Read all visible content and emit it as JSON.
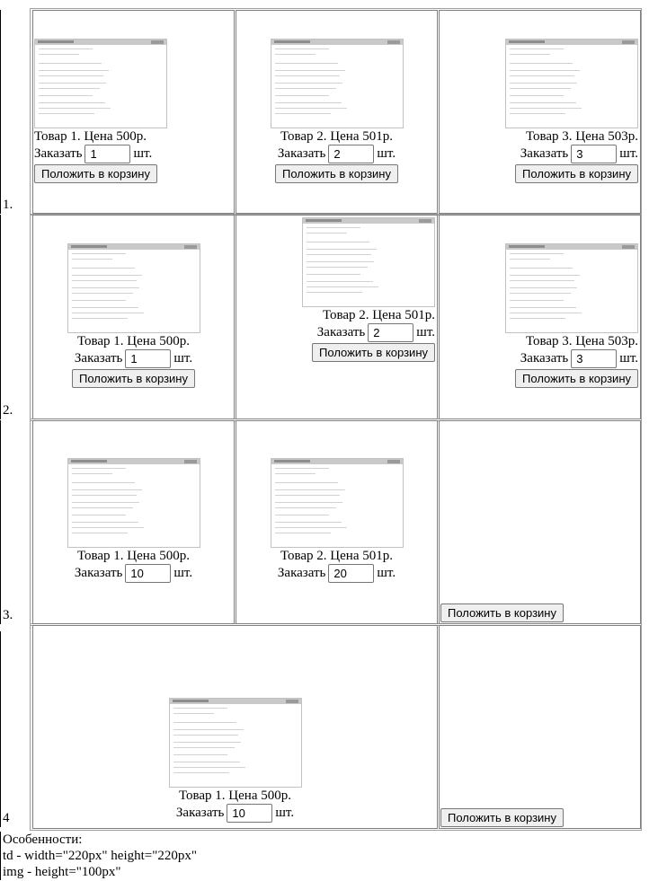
{
  "rows": [
    {
      "label": "1.",
      "cells": [
        {
          "title": "Товар 1. Цена 500р.",
          "order_label": "Заказать",
          "qty": "1",
          "unit": "шт.",
          "button": "Положить в корзину",
          "image": "screenshot-thumbnail"
        },
        {
          "title": "Товар 2. Цена 501р.",
          "order_label": "Заказать",
          "qty": "2",
          "unit": "шт.",
          "button": "Положить в корзину",
          "image": "screenshot-thumbnail"
        },
        {
          "title": "Товар 3. Цена 503р.",
          "order_label": "Заказать",
          "qty": "3",
          "unit": "шт.",
          "button": "Положить в корзину",
          "image": "screenshot-thumbnail"
        }
      ]
    },
    {
      "label": "2.",
      "cells": [
        {
          "title": "Товар 1. Цена 500р.",
          "order_label": "Заказать",
          "qty": "1",
          "unit": "шт.",
          "button": "Положить в корзину",
          "image": "screenshot-thumbnail"
        },
        {
          "title": "Товар 2. Цена 501р.",
          "order_label": "Заказать",
          "qty": "2",
          "unit": "шт.",
          "button": "Положить в корзину",
          "image": "screenshot-thumbnail"
        },
        {
          "title": "Товар 3. Цена 503р.",
          "order_label": "Заказать",
          "qty": "3",
          "unit": "шт.",
          "button": "Положить в корзину",
          "image": "screenshot-thumbnail"
        }
      ]
    },
    {
      "label": "3.",
      "cells": [
        {
          "title": "Товар 1. Цена 500р.",
          "order_label": "Заказать",
          "qty": "10",
          "unit": "шт.",
          "image": "screenshot-thumbnail"
        },
        {
          "title": "Товар 2. Цена 501р.",
          "order_label": "Заказать",
          "qty": "20",
          "unit": "шт.",
          "image": "screenshot-thumbnail"
        },
        {
          "button": "Положить в корзину"
        }
      ]
    },
    {
      "label": "4",
      "cells": [
        {
          "title": "Товар 1. Цена 500р.",
          "order_label": "Заказать",
          "qty": "10",
          "unit": "шт.",
          "image": "screenshot-thumbnail"
        },
        {
          "button": "Положить в корзину"
        }
      ]
    }
  ],
  "notes": {
    "heading": "Особенности:",
    "line1": "td - width=\"220px\" height=\"220px\"",
    "line2": "img - height=\"100px\""
  }
}
